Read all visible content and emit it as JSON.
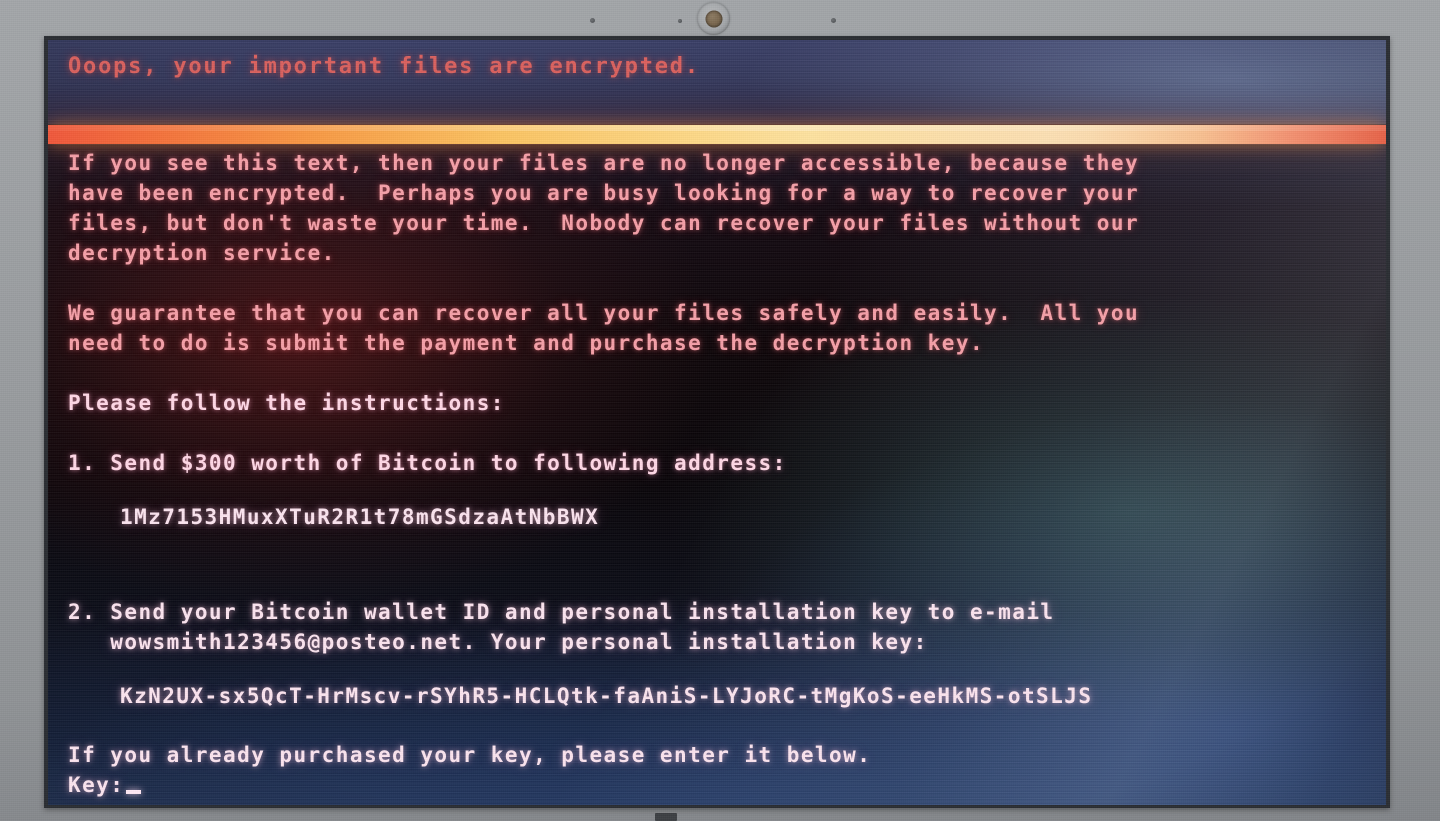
{
  "device": {
    "kind": "laptop",
    "bezel_color": "#989b9e",
    "webcam_label": "webcam"
  },
  "screen": {
    "kind": "ransomware-lock-screen",
    "background_color": "#0d0609",
    "accent_divider_color": "#fbc463",
    "headline_color": "#e8655f",
    "text_color": "#ffd2e0",
    "headline": "Ooops, your important files are encrypted.",
    "paragraph_1": [
      "If you see this text, then your files are no longer accessible, because they",
      "have been encrypted.  Perhaps you are busy looking for a way to recover your",
      "files, but don't waste your time.  Nobody can recover your files without our",
      "decryption service."
    ],
    "paragraph_2": [
      "We guarantee that you can recover all your files safely and easily.  All you",
      "need to do is submit the payment and purchase the decryption key."
    ],
    "instructions_heading": "Please follow the instructions:",
    "step_1": {
      "text": "1. Send $300 worth of Bitcoin to following address:",
      "amount": "$300",
      "currency": "Bitcoin",
      "bitcoin_address": "1Mz7153HMuxXTuR2R1t78mGSdzaAtNbBWX"
    },
    "step_2": {
      "line_1": "2. Send your Bitcoin wallet ID and personal installation key to e-mail",
      "line_2": "   wowsmith123456@posteo.net. Your personal installation key:",
      "email": "wowsmith123456@posteo.net",
      "installation_key": "KzN2UX-sx5QcT-HrMscv-rSYhR5-HCLQtk-faAniS-LYJoRC-tMgKoS-eeHkMS-otSLJS"
    },
    "footer": {
      "prompt_text": "If you already purchased your key, please enter it below.",
      "key_label": "Key:",
      "key_value": "",
      "cursor": "_"
    }
  }
}
